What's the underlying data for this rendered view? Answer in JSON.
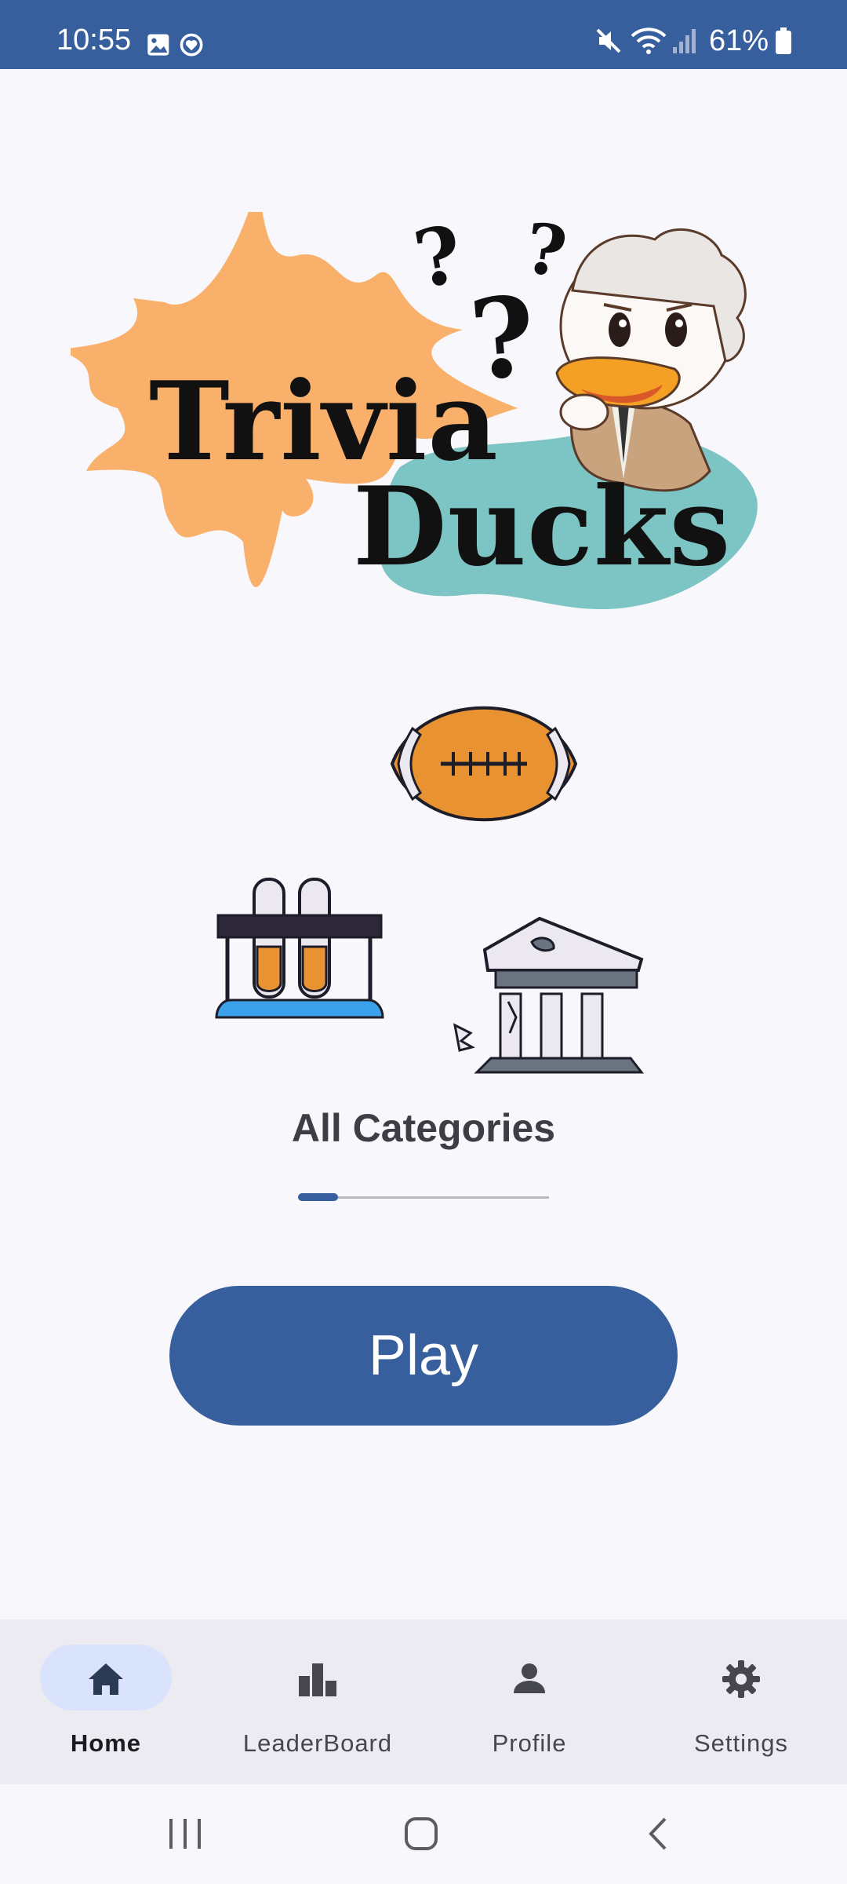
{
  "status_bar": {
    "time": "10:55",
    "battery_percent": "61%",
    "left_icons": [
      "image-icon",
      "heart-badge-icon"
    ],
    "right_icons": [
      "mute-icon",
      "wifi-icon",
      "signal-icon",
      "battery-icon"
    ]
  },
  "logo": {
    "line1": "Trivia",
    "line2": "Ducks",
    "question_marks": [
      "?",
      "?",
      "?"
    ],
    "colors": {
      "splash": "#f9b06a",
      "blob": "#7dc5c4",
      "text": "#111111"
    }
  },
  "carousel": {
    "icons": [
      "football-icon",
      "test-tubes-icon",
      "ancient-temple-icon"
    ],
    "category_label": "All Categories",
    "progress": 0.16
  },
  "play": {
    "label": "Play"
  },
  "bottom_nav": {
    "items": [
      {
        "label": "Home",
        "icon": "home-icon",
        "active": true
      },
      {
        "label": "LeaderBoard",
        "icon": "leaderboard-icon",
        "active": false
      },
      {
        "label": "Profile",
        "icon": "profile-icon",
        "active": false
      },
      {
        "label": "Settings",
        "icon": "settings-icon",
        "active": false
      }
    ]
  },
  "system_nav": {
    "buttons": [
      "recent-apps-icon",
      "home-circle-icon",
      "back-icon"
    ]
  },
  "colors": {
    "primary": "#375f9e",
    "background": "#f8f7fc",
    "nav_background": "#ecebf1",
    "active_indicator": "#d9e3fb"
  }
}
